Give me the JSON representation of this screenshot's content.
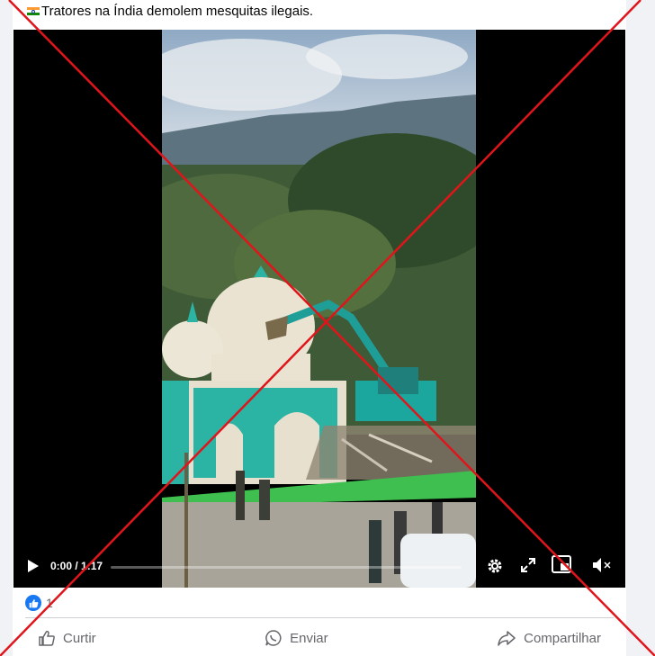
{
  "post": {
    "caption": "Tratores na Índia demolem mesquitas ilegais.",
    "caption_flag_icon": "india-flag-icon"
  },
  "video": {
    "time": "0:00 / 1:17",
    "progress": 0,
    "controls": [
      "play-icon",
      "settings-icon",
      "fullscreen-icon",
      "picture-in-picture-icon",
      "volume-muted-icon"
    ]
  },
  "reactions": {
    "count": "1",
    "icon": "like-badge-icon"
  },
  "actions": {
    "like": "Curtir",
    "send": "Enviar",
    "share": "Compartilhar"
  },
  "colors": {
    "accent": "#1877f2",
    "overlay_x": "#e0151b",
    "muted_text": "#65676b"
  }
}
